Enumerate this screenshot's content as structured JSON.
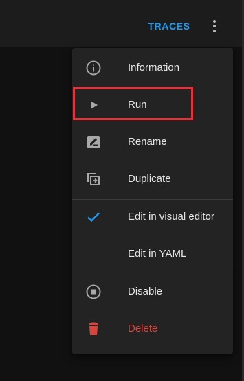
{
  "toolbar": {
    "traces_label": "TRACES",
    "more_icon": "more-vert-icon"
  },
  "menu": {
    "items": [
      {
        "label": "Information",
        "icon": "info-icon"
      },
      {
        "label": "Run",
        "icon": "play-icon"
      },
      {
        "label": "Rename",
        "icon": "rename-icon"
      },
      {
        "label": "Duplicate",
        "icon": "duplicate-icon"
      },
      {
        "label": "Edit in visual editor",
        "icon": "check-icon"
      },
      {
        "label": "Edit in YAML",
        "icon": ""
      },
      {
        "label": "Disable",
        "icon": "stop-circle-icon"
      },
      {
        "label": "Delete",
        "icon": "trash-icon"
      }
    ]
  },
  "colors": {
    "accent": "#1e9bf0",
    "danger": "#d9453b",
    "highlight_border": "#e3323a",
    "menu_background": "#232323"
  }
}
